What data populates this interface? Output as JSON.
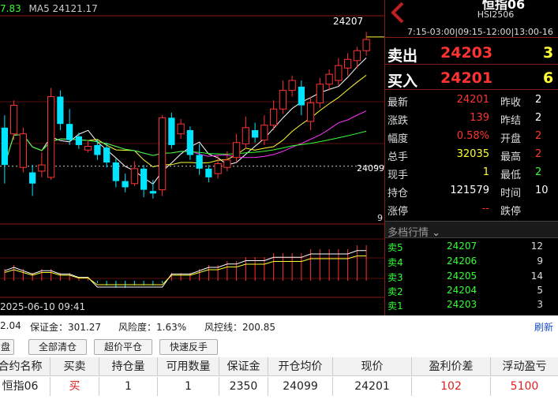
{
  "chart": {
    "ma_value": "7.83",
    "ma5_label": "MA5 24121.17",
    "high_label": "24207",
    "ref_price_label": "24099",
    "volume_axis_label": "9",
    "time_label": "2025-06-10 09:41"
  },
  "chart_data": {
    "type": "candlestick",
    "reference_price": 24099,
    "high": 24207,
    "candles": [
      {
        "o": 24130,
        "c": 24100,
        "h": 24140,
        "l": 24085,
        "up": false
      },
      {
        "o": 24125,
        "c": 24148,
        "h": 24152,
        "l": 24120,
        "up": true
      },
      {
        "o": 24098,
        "c": 24125,
        "h": 24130,
        "l": 24094,
        "up": true
      },
      {
        "o": 24094,
        "c": 24085,
        "h": 24100,
        "l": 24075,
        "up": false
      },
      {
        "o": 24095,
        "c": 24100,
        "h": 24110,
        "l": 24090,
        "up": true
      },
      {
        "o": 24090,
        "c": 24155,
        "h": 24162,
        "l": 24088,
        "up": true
      },
      {
        "o": 24155,
        "c": 24133,
        "h": 24160,
        "l": 24128,
        "up": false
      },
      {
        "o": 24133,
        "c": 24120,
        "h": 24145,
        "l": 24116,
        "up": false
      },
      {
        "o": 24123,
        "c": 24116,
        "h": 24126,
        "l": 24113,
        "up": false
      },
      {
        "o": 24112,
        "c": 24115,
        "h": 24120,
        "l": 24110,
        "up": true
      },
      {
        "o": 24116,
        "c": 24108,
        "h": 24120,
        "l": 24104,
        "up": false
      },
      {
        "o": 24114,
        "c": 24102,
        "h": 24118,
        "l": 24098,
        "up": false
      },
      {
        "o": 24102,
        "c": 24087,
        "h": 24105,
        "l": 24082,
        "up": false
      },
      {
        "o": 24087,
        "c": 24082,
        "h": 24093,
        "l": 24078,
        "up": false
      },
      {
        "o": 24085,
        "c": 24097,
        "h": 24103,
        "l": 24083,
        "up": true
      },
      {
        "o": 24097,
        "c": 24080,
        "h": 24100,
        "l": 24074,
        "up": false
      },
      {
        "o": 24079,
        "c": 24077,
        "h": 24088,
        "l": 24073,
        "up": false
      },
      {
        "o": 24080,
        "c": 24138,
        "h": 24140,
        "l": 24075,
        "up": true
      },
      {
        "o": 24138,
        "c": 24116,
        "h": 24142,
        "l": 24113,
        "up": false
      },
      {
        "o": 24125,
        "c": 24133,
        "h": 24137,
        "l": 24121,
        "up": true
      },
      {
        "o": 24128,
        "c": 24108,
        "h": 24131,
        "l": 24104,
        "up": false
      },
      {
        "o": 24108,
        "c": 24097,
        "h": 24117,
        "l": 24092,
        "up": false
      },
      {
        "o": 24097,
        "c": 24090,
        "h": 24100,
        "l": 24086,
        "up": false
      },
      {
        "o": 24093,
        "c": 24101,
        "h": 24108,
        "l": 24089,
        "up": true
      },
      {
        "o": 24098,
        "c": 24104,
        "h": 24111,
        "l": 24095,
        "up": true
      },
      {
        "o": 24106,
        "c": 24118,
        "h": 24125,
        "l": 24102,
        "up": true
      },
      {
        "o": 24117,
        "c": 24130,
        "h": 24139,
        "l": 24113,
        "up": true
      },
      {
        "o": 24128,
        "c": 24122,
        "h": 24134,
        "l": 24118,
        "up": false
      },
      {
        "o": 24120,
        "c": 24132,
        "h": 24140,
        "l": 24116,
        "up": true
      },
      {
        "o": 24132,
        "c": 24145,
        "h": 24152,
        "l": 24128,
        "up": true
      },
      {
        "o": 24145,
        "c": 24160,
        "h": 24168,
        "l": 24141,
        "up": true
      },
      {
        "o": 24160,
        "c": 24168,
        "h": 24172,
        "l": 24155,
        "up": true
      },
      {
        "o": 24163,
        "c": 24148,
        "h": 24168,
        "l": 24140,
        "up": false
      },
      {
        "o": 24135,
        "c": 24150,
        "h": 24155,
        "l": 24128,
        "up": true
      },
      {
        "o": 24150,
        "c": 24165,
        "h": 24170,
        "l": 24146,
        "up": true
      },
      {
        "o": 24165,
        "c": 24173,
        "h": 24177,
        "l": 24160,
        "up": true
      },
      {
        "o": 24168,
        "c": 24180,
        "h": 24186,
        "l": 24164,
        "up": true
      },
      {
        "o": 24178,
        "c": 24185,
        "h": 24190,
        "l": 24172,
        "up": true
      },
      {
        "o": 24184,
        "c": 24192,
        "h": 24195,
        "l": 24178,
        "up": true
      },
      {
        "o": 24192,
        "c": 24201,
        "h": 24207,
        "l": 24188,
        "up": true
      }
    ],
    "volume": [
      3,
      4,
      3,
      2,
      3,
      3,
      2,
      2,
      1,
      1,
      1,
      2,
      3,
      3,
      2,
      2,
      2,
      1,
      2,
      2,
      2,
      3,
      4,
      4,
      5,
      5,
      6,
      6,
      6,
      7,
      7,
      7,
      7,
      8,
      8,
      8,
      8,
      8,
      9,
      9
    ],
    "series": [
      {
        "name": "MA5",
        "color": "#ffffff"
      },
      {
        "name": "MA10",
        "color": "#ffff33"
      },
      {
        "name": "MA20",
        "color": "#ff33ff"
      },
      {
        "name": "MA60",
        "color": "#33ff33"
      }
    ]
  },
  "instrument": {
    "name": "恒指06",
    "code": "HSI2506",
    "session": "7:15-03:00|09:15-12:00|13:00-16"
  },
  "quotes": {
    "ask_label": "卖出",
    "ask_price": "24203",
    "ask_vol": "3",
    "bid_label": "买入",
    "bid_price": "24201",
    "bid_vol": "6"
  },
  "stats_left": [
    {
      "label": "最新",
      "value": "24201",
      "color": "red"
    },
    {
      "label": "涨跌",
      "value": "139",
      "color": "red"
    },
    {
      "label": "幅度",
      "value": "0.58%",
      "color": "red"
    },
    {
      "label": "总手",
      "value": "32035",
      "color": "yellow"
    },
    {
      "label": "现手",
      "value": "1",
      "color": "yellow"
    },
    {
      "label": "持仓",
      "value": "121579",
      "color": "white"
    },
    {
      "label": "涨停",
      "value": "--",
      "color": "red"
    }
  ],
  "stats_right": [
    {
      "label": "昨收",
      "value": "2"
    },
    {
      "label": "昨结",
      "value": "2"
    },
    {
      "label": "开盘",
      "value": "2"
    },
    {
      "label": "最高",
      "value": "2"
    },
    {
      "label": "最低",
      "value": "2"
    },
    {
      "label": "时间",
      "value": "10"
    },
    {
      "label": "跌停",
      "value": ""
    }
  ],
  "depth": {
    "title": "多档行情",
    "rows": [
      {
        "label": "卖5",
        "price": "24207",
        "vol": "12"
      },
      {
        "label": "卖4",
        "price": "24206",
        "vol": "9"
      },
      {
        "label": "卖3",
        "price": "24205",
        "vol": "14"
      },
      {
        "label": "卖2",
        "price": "24204",
        "vol": "5"
      },
      {
        "label": "卖1",
        "price": "24203",
        "vol": "3"
      }
    ]
  },
  "account": {
    "balance_partial": "2.04",
    "margin": "保证金：301.27",
    "risk": "风险度：1.63%",
    "control_line": "风控线：200.85",
    "refresh": "刷新"
  },
  "buttons": {
    "tab_partial": "盘",
    "close_all": "全部清仓",
    "super_close": "超价平仓",
    "quick_reverse": "快速反手"
  },
  "positions": {
    "headers": [
      "合约名称",
      "买卖",
      "持仓量",
      "可用数量",
      "保证金",
      "开仓均价",
      "现价",
      "盈利价差",
      "浮动盈亏"
    ],
    "rows": [
      [
        "恒指06",
        "买",
        "1",
        "1",
        "2350",
        "24099",
        "24201",
        "102",
        "5100"
      ]
    ]
  }
}
